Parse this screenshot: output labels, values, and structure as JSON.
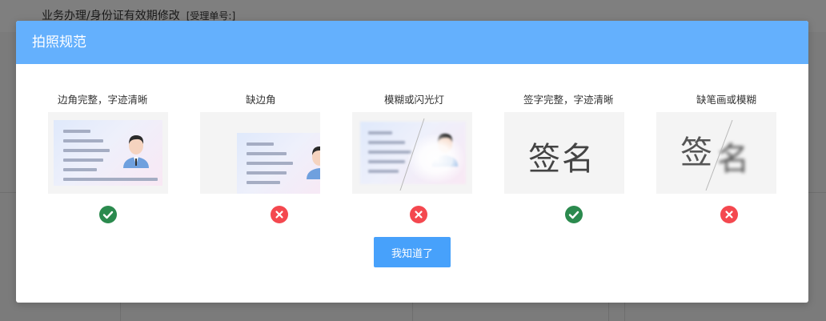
{
  "background": {
    "breadcrumb": "业务办理/身份证有效期修改",
    "order_label": "[受理单号:]"
  },
  "modal": {
    "title": "拍照规范",
    "confirm_label": "我知道了"
  },
  "cards": [
    {
      "label": "边角完整，字迹清晰",
      "status": "ok",
      "icon": "check-icon"
    },
    {
      "label": "缺边角",
      "status": "bad",
      "icon": "cross-icon"
    },
    {
      "label": "模糊或闪光灯",
      "status": "bad",
      "icon": "cross-icon"
    },
    {
      "label": "签字完整，字迹清晰",
      "status": "ok",
      "icon": "check-icon"
    },
    {
      "label": "缺笔画或模糊",
      "status": "bad",
      "icon": "cross-icon"
    }
  ],
  "signature_text": "签名",
  "colors": {
    "header": "#64b0fd",
    "button": "#47a1fb",
    "ok": "#2b8a4e",
    "bad": "#f4484f"
  }
}
